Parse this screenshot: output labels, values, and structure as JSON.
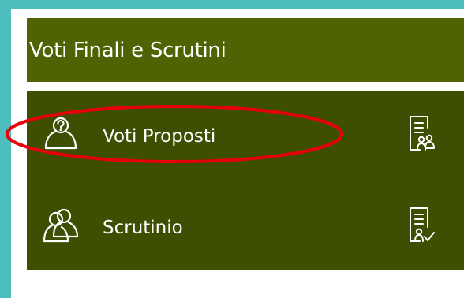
{
  "section": {
    "title": "Voti Finali e Scrutini"
  },
  "menu": {
    "items": [
      {
        "label": "Voti Proposti",
        "icon": "user-question-icon",
        "action_icon": "document-users-icon"
      },
      {
        "label": "Scrutinio",
        "icon": "users-icon",
        "action_icon": "document-check-icon"
      }
    ]
  },
  "colors": {
    "background": "#4dbdbd",
    "header": "#4e6404",
    "menu": "#3e4e03",
    "highlight": "#e8000a",
    "text": "#ffffff"
  }
}
